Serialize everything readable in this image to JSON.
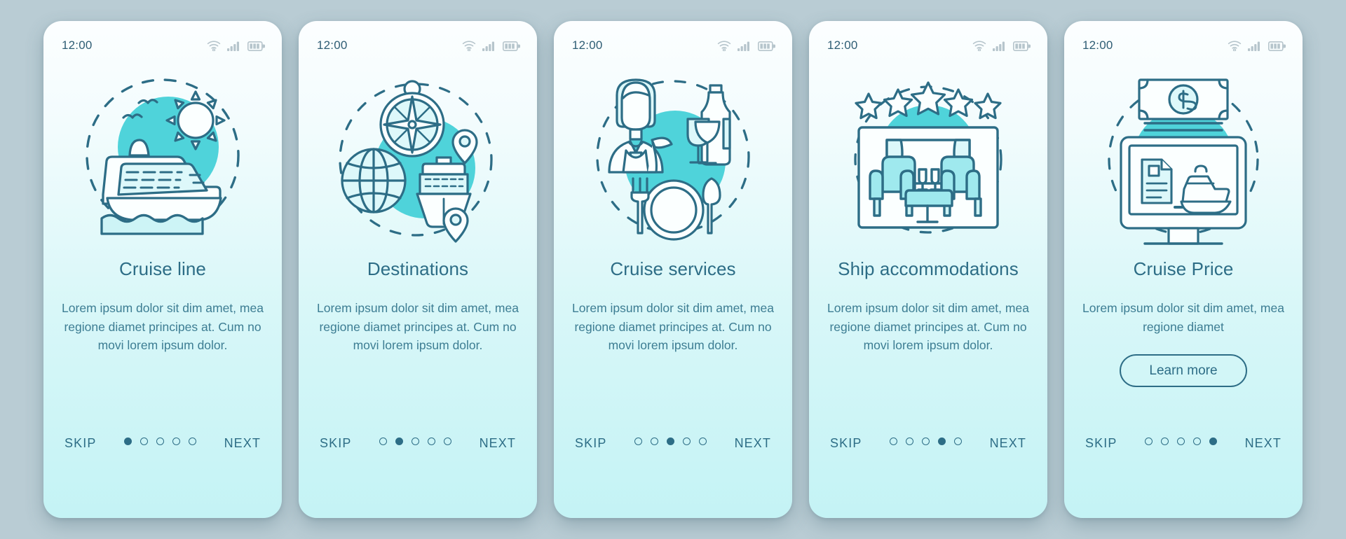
{
  "theme": {
    "page_background": "#b9ccd4",
    "accent": "#2d6d86",
    "body_text": "#3d7d93",
    "illustration_fill": "#4fd3da",
    "card_gradient_top": "#fcfeff",
    "card_gradient_bottom": "#c4f3f5"
  },
  "statusbar": {
    "time": "12:00",
    "icons": [
      "wifi-icon",
      "cellular-signal-icon",
      "battery-icon"
    ]
  },
  "footer": {
    "skip_label": "SKIP",
    "next_label": "NEXT",
    "total_dots": 5
  },
  "screens": [
    {
      "id": "cruise-line",
      "illustration": "cruise-ship-sun-illustration",
      "title": "Cruise line",
      "description": "Lorem ipsum dolor sit dim amet, mea regione diamet principes at. Cum no movi lorem ipsum dolor.",
      "active_dot": 1,
      "cta": null
    },
    {
      "id": "destinations",
      "illustration": "compass-globe-ship-pins-illustration",
      "title": "Destinations",
      "description": "Lorem ipsum dolor sit dim amet, mea regione diamet principes at. Cum no movi lorem ipsum dolor.",
      "active_dot": 2,
      "cta": null
    },
    {
      "id": "cruise-services",
      "illustration": "waitress-dinner-wine-illustration",
      "title": "Cruise services",
      "description": "Lorem ipsum dolor sit dim amet, mea regione diamet principes at. Cum no movi lorem ipsum dolor.",
      "active_dot": 3,
      "cta": null
    },
    {
      "id": "ship-accommodations",
      "illustration": "five-stars-lounge-illustration",
      "title": "Ship accommodations",
      "description": "Lorem ipsum dolor sit dim amet, mea regione diamet principes at. Cum no movi lorem ipsum dolor.",
      "active_dot": 4,
      "cta": null
    },
    {
      "id": "cruise-price",
      "illustration": "money-monitor-booking-illustration",
      "title": "Cruise Price",
      "description": "Lorem ipsum dolor sit dim amet, mea regione diamet",
      "active_dot": 5,
      "cta": "Learn more"
    }
  ]
}
